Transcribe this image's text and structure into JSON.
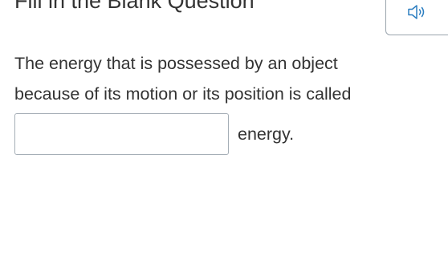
{
  "header": {
    "title": "Fill in the Blank Question",
    "audio_icon": "speaker-icon"
  },
  "question": {
    "line1": "The energy that is possessed by an object",
    "line2": "because of its motion or its position is called",
    "blank_value": "",
    "after_blank": "energy."
  },
  "colors": {
    "text": "#333333",
    "border": "#a5aeb6",
    "icon": "#2d7fc1"
  }
}
